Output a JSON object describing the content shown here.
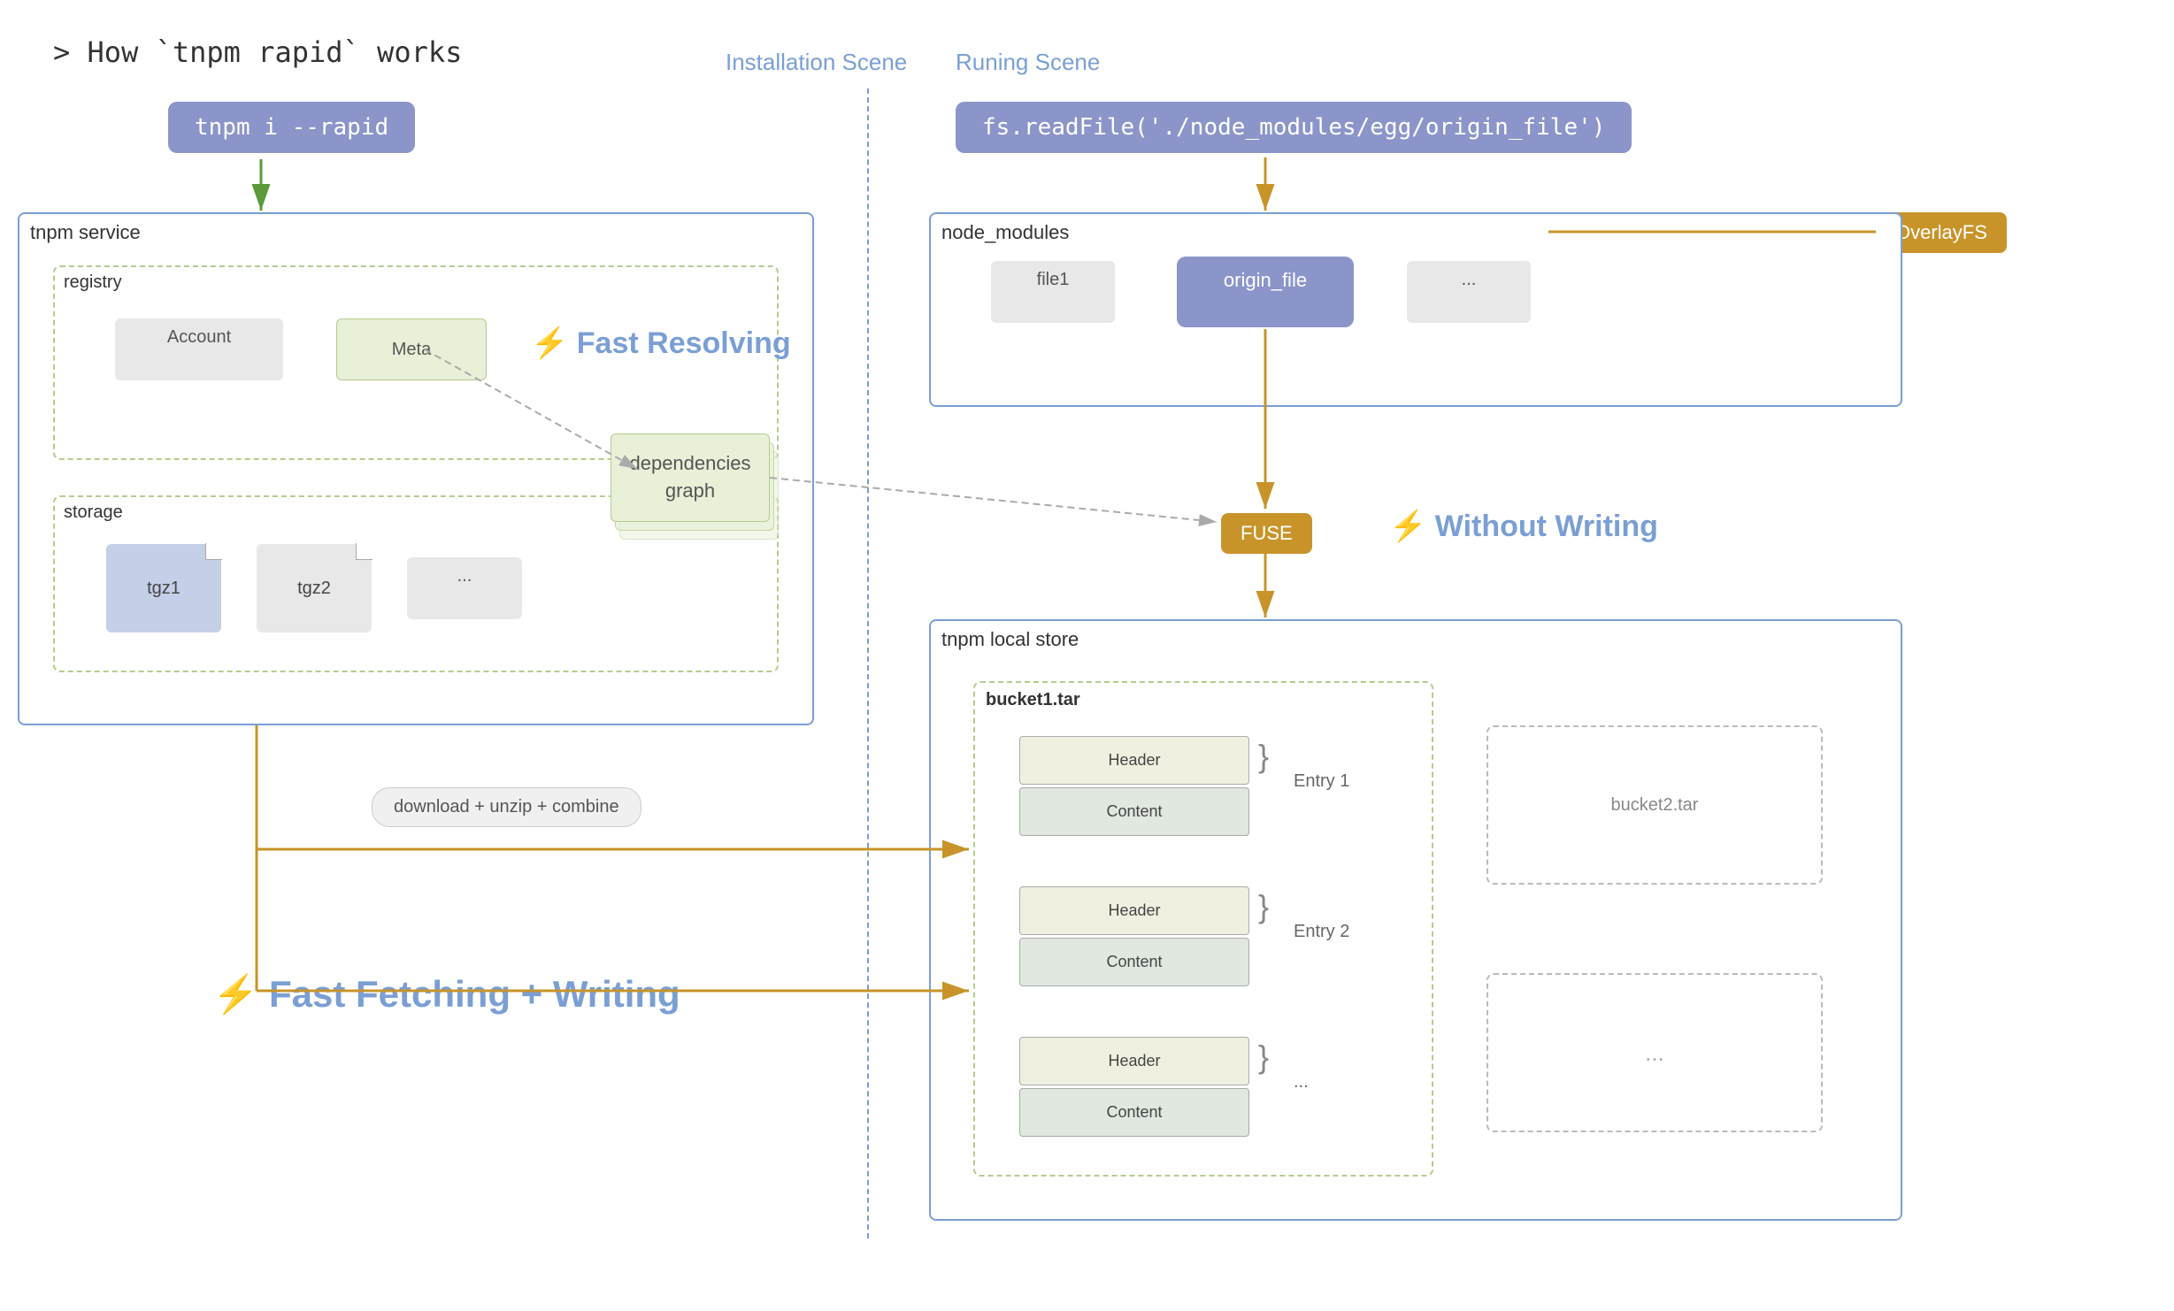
{
  "title": "> How `tnpm rapid` works",
  "scene_labels": {
    "installation": "Installation Scene",
    "running": "Runing Scene"
  },
  "left_cmd": "tnpm i --rapid",
  "read_file_cmd": "fs.readFile('./node_modules/egg/origin_file')",
  "overlayfs_label": "OverlayFS",
  "fuse_label": "FUSE",
  "tnpm_service_label": "tnpm service",
  "registry_label": "registry",
  "storage_label": "storage",
  "node_modules_label": "node_modules",
  "tnpm_local_store_label": "tnpm local store",
  "account_label": "Account",
  "meta_label": "Meta",
  "tgz1_label": "tgz1",
  "tgz2_label": "tgz2",
  "ellipsis": "...",
  "file1_label": "file1",
  "origin_file_label": "origin_file",
  "dep_graph_label": "dependencies\ngraph",
  "download_label": "download + unzip + combine",
  "bucket1_label": "bucket1.tar",
  "bucket2_label": "bucket2.tar",
  "entry1_label": "Entry 1",
  "entry2_label": "Entry 2",
  "fast_resolving": "⚡ Fast Resolving",
  "without_writing": "⚡ Without Writing",
  "fast_fetching": "⚡ Fast Fetching + Writing",
  "tar_entries": [
    "Header",
    "Content",
    "Header",
    "Content",
    "Header",
    "Content"
  ],
  "colors": {
    "blue_accent": "#7a9fd4",
    "gold": "#c8942a",
    "green_dashed": "#b5cc8e",
    "cmd_bg": "#8b95c9"
  }
}
